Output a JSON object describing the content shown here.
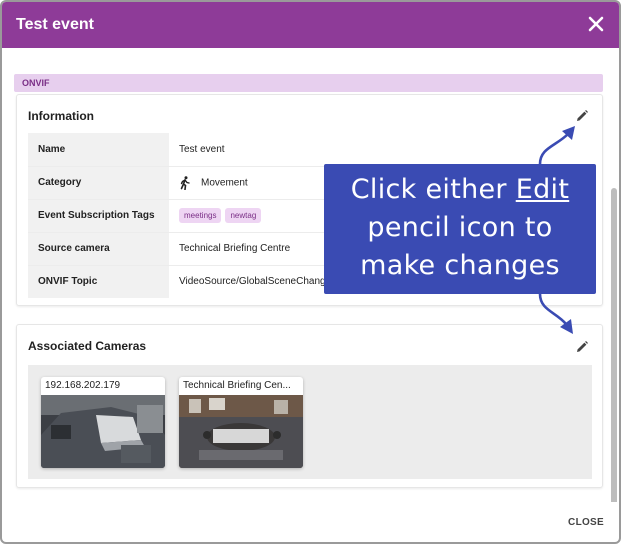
{
  "dialog": {
    "title": "Test event",
    "close_label": "CLOSE"
  },
  "onvif": {
    "label": "ONVIF"
  },
  "information": {
    "title": "Information",
    "rows": [
      {
        "label": "Name",
        "value": "Test event"
      },
      {
        "label": "Category",
        "value": "Movement",
        "icon": "walking-person-icon"
      },
      {
        "label": "Event Subscription Tags",
        "tags": [
          "meetings",
          "newtag"
        ]
      },
      {
        "label": "Source camera",
        "value": "Technical Briefing Centre"
      },
      {
        "label": "ONVIF Topic",
        "value": "VideoSource/GlobalSceneChange"
      }
    ]
  },
  "cameras": {
    "title": "Associated Cameras",
    "items": [
      {
        "name": "192.168.202.179"
      },
      {
        "name": "Technical Briefing Cen..."
      }
    ]
  },
  "callout": {
    "line1_prefix": "Click either ",
    "line1_underlined": "Edit",
    "line2": "pencil icon to",
    "line3": "make changes"
  },
  "colors": {
    "header": "#8e3b98",
    "callout": "#3a4bb3",
    "tag": "#eed5f3"
  }
}
